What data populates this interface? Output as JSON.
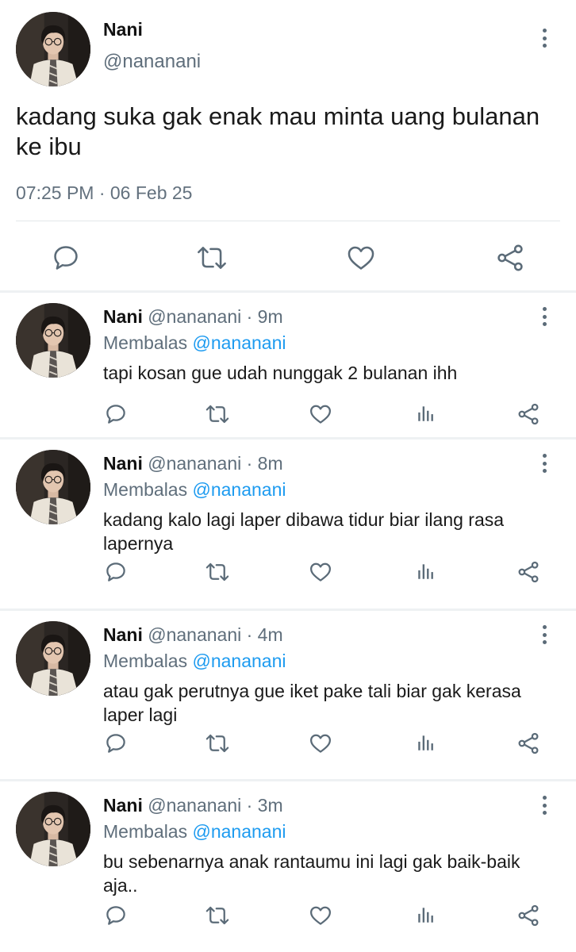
{
  "main_tweet": {
    "name": "Nani",
    "handle": "@nananani",
    "text": "kadang suka gak enak mau minta uang bulanan ke ibu",
    "meta": "07:25 PM · 06 Feb 25",
    "actions": [
      "reply-icon",
      "retweet-icon",
      "like-icon",
      "share-icon"
    ]
  },
  "replies": [
    {
      "name": "Nani",
      "handle": "@nananani",
      "time": "· 9m",
      "replying_label": "Membalas",
      "replying_to": "@nananani",
      "text": "tapi kosan gue udah nunggak 2 bulanan ihh"
    },
    {
      "name": "Nani",
      "handle": "@nananani",
      "time": "· 8m",
      "replying_label": "Membalas",
      "replying_to": "@nananani",
      "text": "kadang kalo lagi laper dibawa tidur biar ilang rasa lapernya"
    },
    {
      "name": "Nani",
      "handle": "@nananani",
      "time": "· 4m",
      "replying_label": "Membalas",
      "replying_to": "@nananani",
      "text": "atau gak perutnya gue iket pake tali biar gak kerasa laper lagi"
    },
    {
      "name": "Nani",
      "handle": "@nananani",
      "time": "· 3m",
      "replying_label": "Membalas",
      "replying_to": "@nananani",
      "text": "bu sebenarnya anak rantaumu ini lagi gak baik-baik aja.."
    }
  ],
  "colors": {
    "text": "#0f1419",
    "secondary": "#5f6e7b",
    "mention": "#1d9bf0",
    "icon": "#5b6b78",
    "divider": "#eef1f3"
  }
}
